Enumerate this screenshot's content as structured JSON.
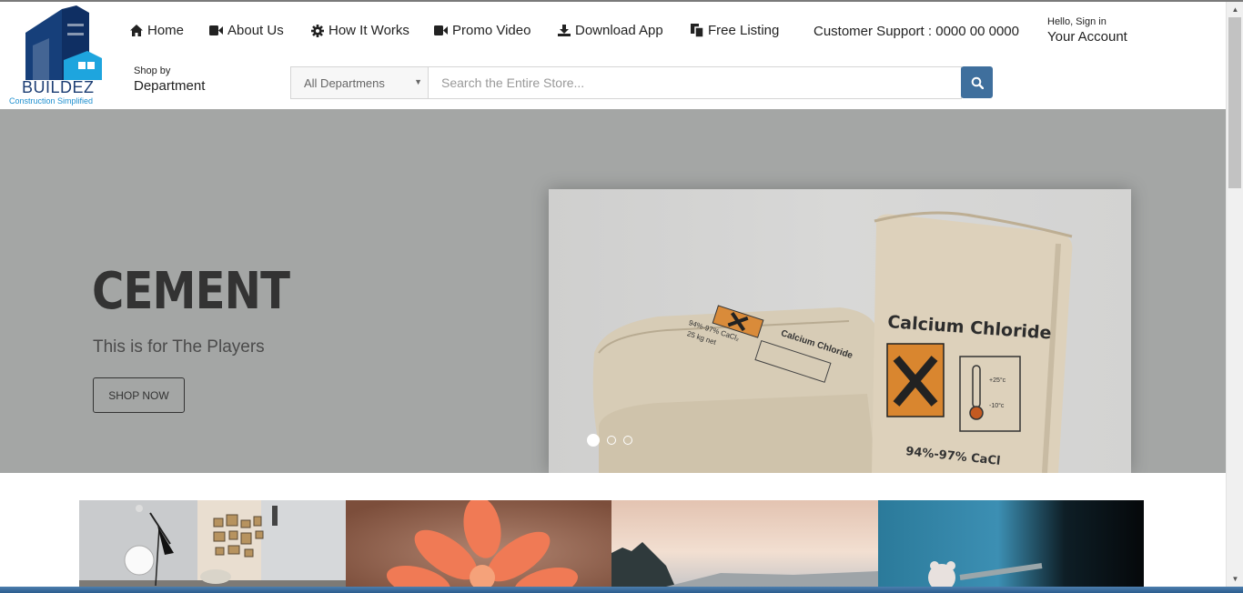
{
  "brand": {
    "name": "BUILDEZ",
    "tagline": "Construction Simplified"
  },
  "nav": [
    {
      "label": "Home",
      "icon": "home-icon"
    },
    {
      "label": "About Us",
      "icon": "video-camera-icon"
    },
    {
      "label": "How It Works",
      "icon": "gear-icon"
    },
    {
      "label": "Promo Video",
      "icon": "video-camera-icon"
    },
    {
      "label": "Download App",
      "icon": "download-icon"
    },
    {
      "label": "Free Listing",
      "icon": "copy-icon"
    }
  ],
  "support": "Customer Support : 0000 00 0000",
  "account": {
    "greeting": "Hello, Sign in",
    "label": "Your Account"
  },
  "shop_by": {
    "line1": "Shop by",
    "line2": "Department"
  },
  "search": {
    "department": "All Departmens",
    "placeholder": "Search the Entire Store..."
  },
  "hero": {
    "title": "CEMENT",
    "subtitle": "This is for The Players",
    "button": "SHOP NOW",
    "bag_label_large": "Calcium Chloride",
    "bag_label_large_percent": "94%-97% CaCl",
    "bag_label_small": "Calcium Chloride",
    "bag_label_small_percent": "94%-97% CaCl₂",
    "bag_label_small_weight": "25 kg net",
    "temp_high": "+25°c",
    "temp_low": "-10°c",
    "slides": 3,
    "active_slide": 1
  },
  "colors": {
    "accent": "#3f6f9d",
    "hero_bg": "#a4a6a5",
    "brand_blue": "#1d3e74",
    "brand_cyan": "#1d8fcf"
  }
}
